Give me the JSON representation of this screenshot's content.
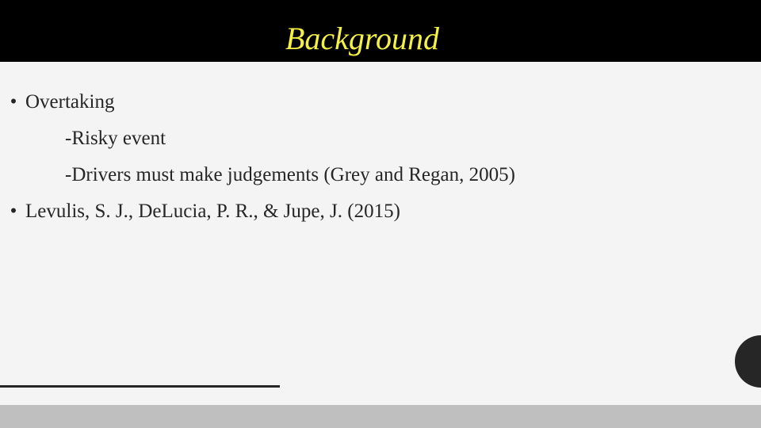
{
  "slide": {
    "title": "Background",
    "bullets": [
      {
        "marker": "•",
        "text": "Overtaking",
        "subitems": [
          "-Risky event",
          "-Drivers must make judgements (Grey and Regan, 2005)"
        ]
      },
      {
        "marker": "•",
        "text": "Levulis, S. J., DeLucia, P. R., & Jupe, J. (2015)",
        "subitems": []
      }
    ]
  },
  "colors": {
    "title_bar": "#000000",
    "title_text": "#f4f045",
    "background": "#f4f4f4",
    "body_text": "#262626",
    "accent_dark": "#262626",
    "footer_bar": "#bfbfbf"
  }
}
